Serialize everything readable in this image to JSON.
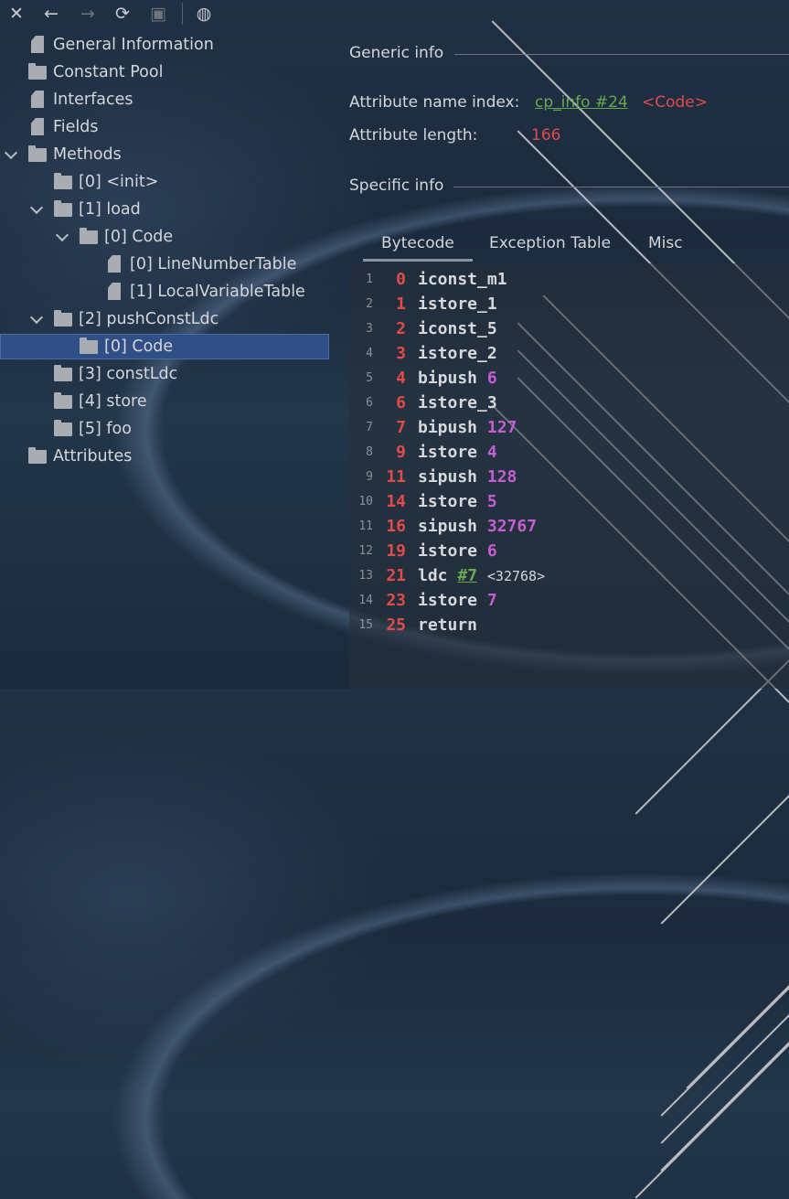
{
  "toolbar": {
    "buttons": [
      {
        "name": "close",
        "glyph": "✕"
      },
      {
        "name": "back",
        "glyph": "←"
      },
      {
        "name": "forward",
        "glyph": "→"
      },
      {
        "name": "refresh",
        "glyph": "⟳"
      },
      {
        "name": "save",
        "glyph": "▣"
      },
      {
        "name": "web",
        "glyph": "◍"
      }
    ]
  },
  "tree": {
    "items": [
      {
        "label": "General Information",
        "icon": "file",
        "level": 0,
        "chevron": "none"
      },
      {
        "label": "Constant Pool",
        "icon": "folder",
        "level": 0,
        "chevron": "right"
      },
      {
        "label": "Interfaces",
        "icon": "file",
        "level": 0,
        "chevron": "none"
      },
      {
        "label": "Fields",
        "icon": "file",
        "level": 0,
        "chevron": "none"
      },
      {
        "label": "Methods",
        "icon": "folder",
        "level": 0,
        "chevron": "down"
      },
      {
        "label": "[0] <init>",
        "icon": "folder",
        "level": 1,
        "chevron": "right"
      },
      {
        "label": "[1] load",
        "icon": "folder",
        "level": 1,
        "chevron": "down"
      },
      {
        "label": "[0] Code",
        "icon": "folder",
        "level": 2,
        "chevron": "down"
      },
      {
        "label": "[0] LineNumberTable",
        "icon": "file",
        "level": 3,
        "chevron": "none"
      },
      {
        "label": "[1] LocalVariableTable",
        "icon": "file",
        "level": 3,
        "chevron": "none"
      },
      {
        "label": "[2] pushConstLdc",
        "icon": "folder",
        "level": 1,
        "chevron": "down"
      },
      {
        "label": "[0] Code",
        "icon": "folder",
        "level": 2,
        "chevron": "right",
        "selected": true
      },
      {
        "label": "[3] constLdc",
        "icon": "folder",
        "level": 1,
        "chevron": "right"
      },
      {
        "label": "[4] store",
        "icon": "folder",
        "level": 1,
        "chevron": "right"
      },
      {
        "label": "[5] foo",
        "icon": "folder",
        "level": 1,
        "chevron": "right"
      },
      {
        "label": "Attributes",
        "icon": "folder",
        "level": 0,
        "chevron": "right"
      }
    ]
  },
  "generic": {
    "title": "Generic info",
    "name_index_label": "Attribute name index:",
    "name_index_link": "cp_info #24",
    "name_index_value": "<Code>",
    "length_label": "Attribute length:",
    "length_value": "166"
  },
  "specific": {
    "title": "Specific info",
    "tabs": [
      "Bytecode",
      "Exception Table",
      "Misc"
    ]
  },
  "bytecode": [
    {
      "ln": "1",
      "off": "0",
      "op": "iconst_m1",
      "arg": "",
      "argType": ""
    },
    {
      "ln": "2",
      "off": "1",
      "op": "istore_1",
      "arg": "",
      "argType": ""
    },
    {
      "ln": "3",
      "off": "2",
      "op": "iconst_5",
      "arg": "",
      "argType": ""
    },
    {
      "ln": "4",
      "off": "3",
      "op": "istore_2",
      "arg": "",
      "argType": ""
    },
    {
      "ln": "5",
      "off": "4",
      "op": "bipush",
      "arg": "6",
      "argType": "num"
    },
    {
      "ln": "6",
      "off": "6",
      "op": "istore_3",
      "arg": "",
      "argType": ""
    },
    {
      "ln": "7",
      "off": "7",
      "op": "bipush",
      "arg": "127",
      "argType": "num"
    },
    {
      "ln": "8",
      "off": "9",
      "op": "istore",
      "arg": "4",
      "argType": "num"
    },
    {
      "ln": "9",
      "off": "11",
      "op": "sipush",
      "arg": "128",
      "argType": "num"
    },
    {
      "ln": "10",
      "off": "14",
      "op": "istore",
      "arg": "5",
      "argType": "num"
    },
    {
      "ln": "11",
      "off": "16",
      "op": "sipush",
      "arg": "32767",
      "argType": "num"
    },
    {
      "ln": "12",
      "off": "19",
      "op": "istore",
      "arg": "6",
      "argType": "num"
    },
    {
      "ln": "13",
      "off": "21",
      "op": "ldc",
      "arg": "#7",
      "argType": "link",
      "comment": "<32768>"
    },
    {
      "ln": "14",
      "off": "23",
      "op": "istore",
      "arg": "7",
      "argType": "num"
    },
    {
      "ln": "15",
      "off": "25",
      "op": "return",
      "arg": "",
      "argType": ""
    }
  ]
}
